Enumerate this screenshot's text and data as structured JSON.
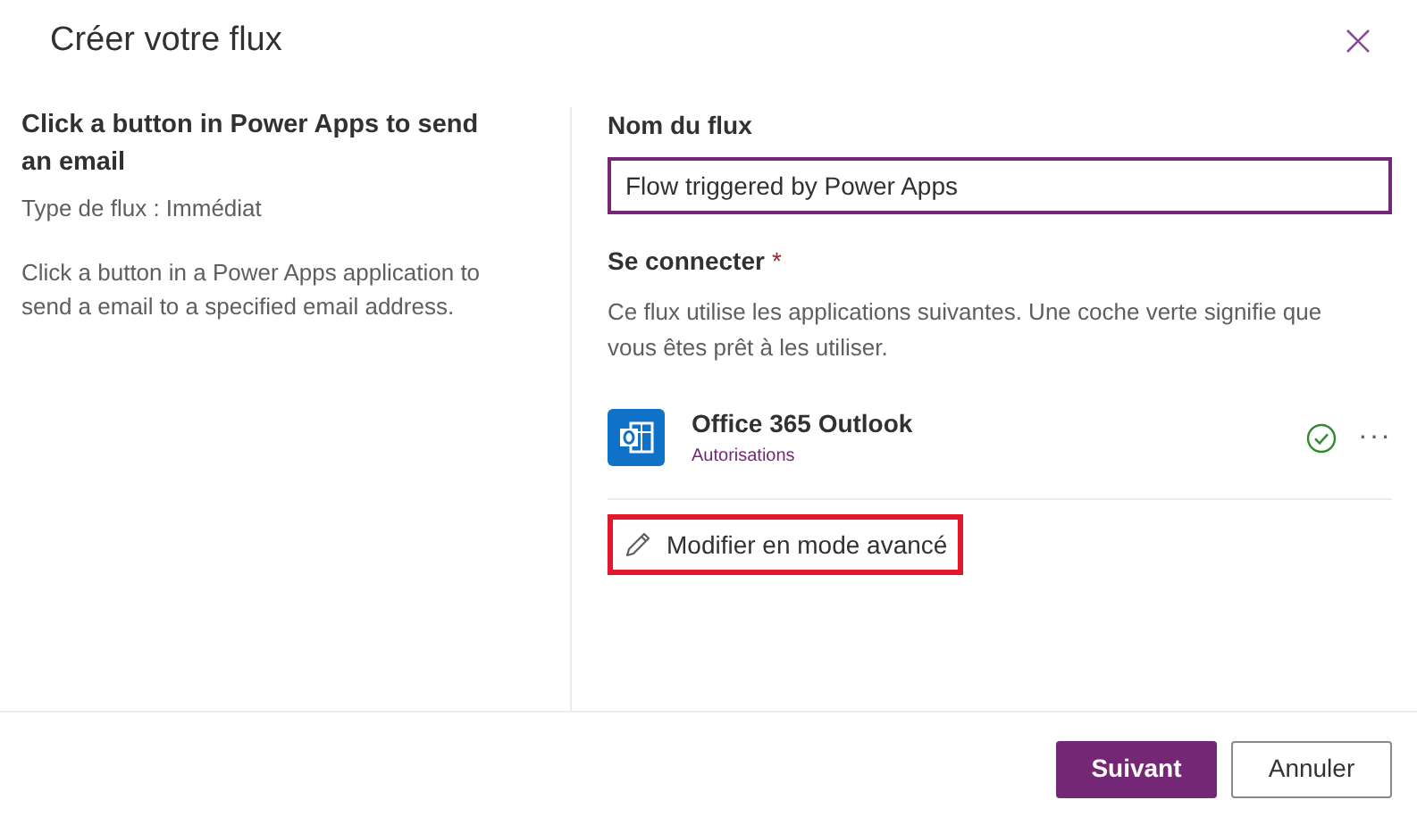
{
  "dialog": {
    "title": "Créer votre flux"
  },
  "template": {
    "title": "Click a button in Power Apps to send an email",
    "flow_type": "Type de flux : Immédiat",
    "description": "Click a button in a Power Apps application to send a email to a specified email address."
  },
  "flow_name": {
    "label": "Nom du flux",
    "value": "Flow triggered by Power Apps"
  },
  "connect": {
    "label": "Se connecter",
    "required_mark": "*",
    "help": "Ce flux utilise les applications suivantes. Une coche verte signifie que vous êtes prêt à les utiliser.",
    "connections": [
      {
        "name": "Office 365 Outlook",
        "link": "Autorisations",
        "connected": true,
        "more": "···"
      }
    ]
  },
  "advanced_link": {
    "label": "Modifier en mode avancé",
    "highlighted": true
  },
  "buttons": [
    {
      "label": "Suivant",
      "kind": "primary"
    },
    {
      "label": "Annuler",
      "kind": "secondary"
    }
  ]
}
